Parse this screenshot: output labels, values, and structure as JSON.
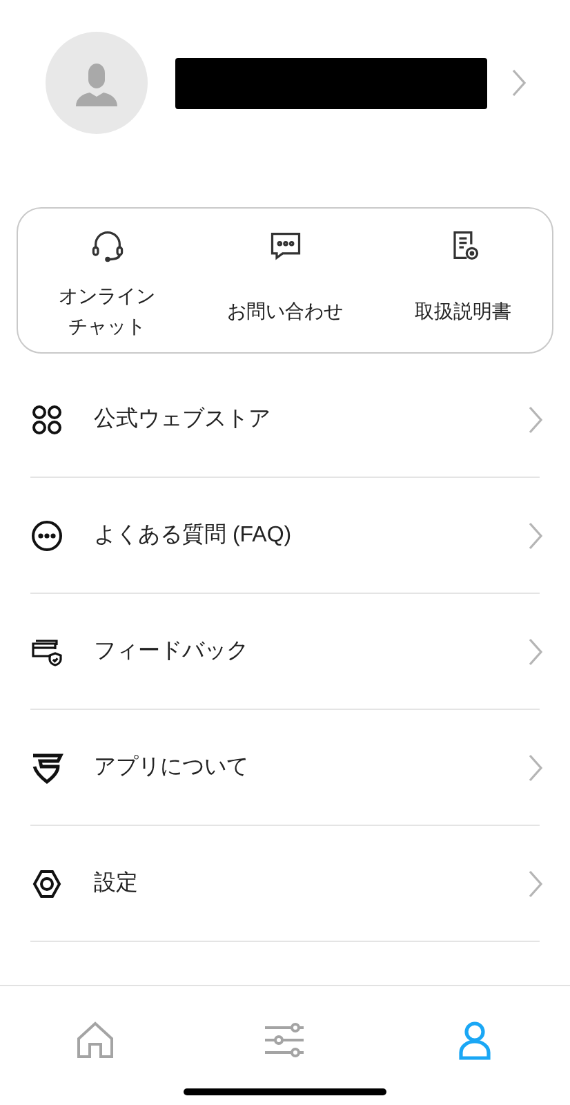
{
  "profile": {
    "name_redacted": true
  },
  "quick_actions": [
    {
      "kind": "headset",
      "label": "オンラインチャット"
    },
    {
      "kind": "chat",
      "label": "お問い合わせ"
    },
    {
      "kind": "manual",
      "label": "取扱説明書"
    }
  ],
  "menu": [
    {
      "kind": "store",
      "label": "公式ウェブストア"
    },
    {
      "kind": "faq",
      "label": "よくある質問 (FAQ)"
    },
    {
      "kind": "feedback",
      "label": "フィードバック"
    },
    {
      "kind": "about",
      "label": "アプリについて"
    },
    {
      "kind": "settings",
      "label": "設定"
    }
  ],
  "tabs": [
    {
      "kind": "home",
      "selected": false
    },
    {
      "kind": "controls",
      "selected": false
    },
    {
      "kind": "account",
      "selected": true
    }
  ]
}
